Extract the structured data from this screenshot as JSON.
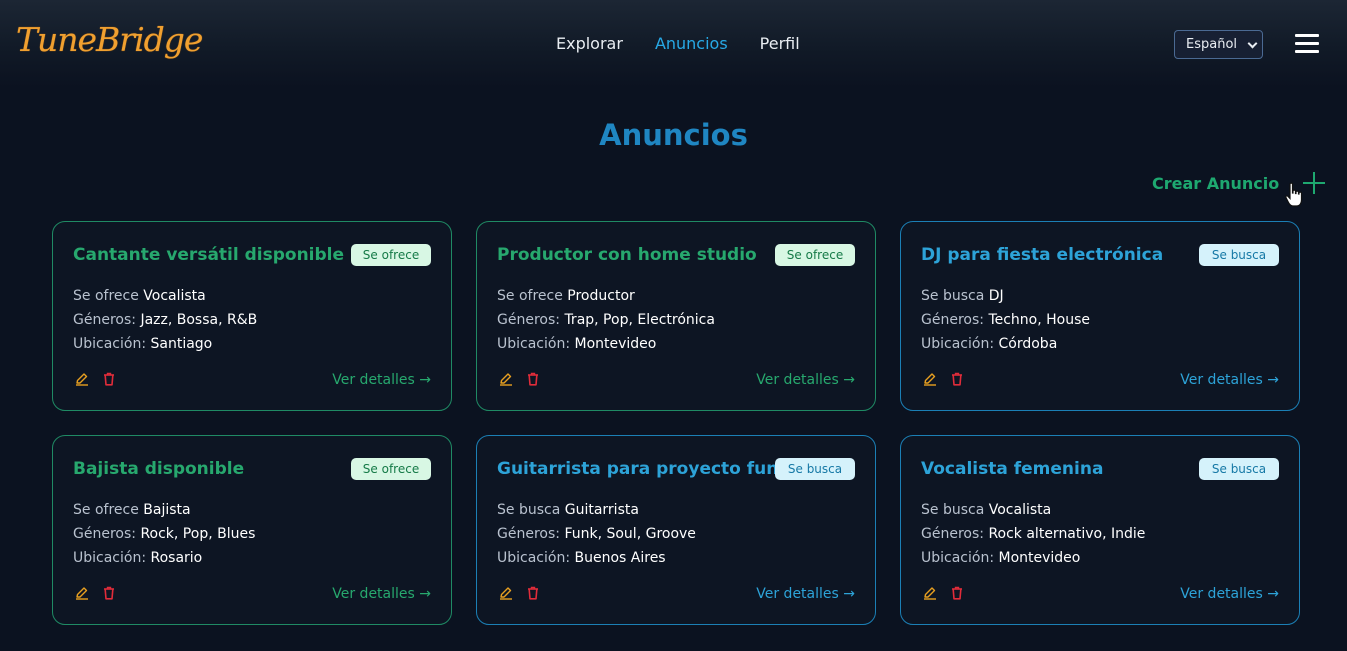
{
  "app": {
    "logo": "TuneBridge"
  },
  "nav": {
    "items": [
      {
        "label": "Explorar",
        "active": false
      },
      {
        "label": "Anuncios",
        "active": true
      },
      {
        "label": "Perfil",
        "active": false
      }
    ]
  },
  "language": {
    "selected": "Español"
  },
  "page": {
    "title": "Anuncios",
    "create_label": "Crear Anuncio"
  },
  "labels": {
    "genres": "Géneros:",
    "location": "Ubicación:",
    "details": "Ver detalles →"
  },
  "colors": {
    "offer": "#27a86e",
    "seek": "#2da3d8",
    "accent_title": "#1f86c2",
    "logo": "#f0a030"
  },
  "cards": [
    {
      "title": "Cantante versátil disponible",
      "badge": "Se ofrece",
      "role_prefix": "Se ofrece",
      "role": "Vocalista",
      "genres": "Jazz, Bossa, R&B",
      "location": "Santiago",
      "kind": "green"
    },
    {
      "title": "Productor con home studio",
      "badge": "Se ofrece",
      "role_prefix": "Se ofrece",
      "role": "Productor",
      "genres": "Trap, Pop, Electrónica",
      "location": "Montevideo",
      "kind": "green"
    },
    {
      "title": "DJ para fiesta electrónica",
      "badge": "Se busca",
      "role_prefix": "Se busca",
      "role": "DJ",
      "genres": "Techno, House",
      "location": "Córdoba",
      "kind": "blue"
    },
    {
      "title": "Bajista disponible",
      "badge": "Se ofrece",
      "role_prefix": "Se ofrece",
      "role": "Bajista",
      "genres": "Rock, Pop, Blues",
      "location": "Rosario",
      "kind": "green"
    },
    {
      "title": "Guitarrista para proyecto funk",
      "badge": "Se busca",
      "role_prefix": "Se busca",
      "role": "Guitarrista",
      "genres": "Funk, Soul, Groove",
      "location": "Buenos Aires",
      "kind": "blue"
    },
    {
      "title": "Vocalista femenina",
      "badge": "Se busca",
      "role_prefix": "Se busca",
      "role": "Vocalista",
      "genres": "Rock alternativo, Indie",
      "location": "Montevideo",
      "kind": "blue"
    }
  ]
}
